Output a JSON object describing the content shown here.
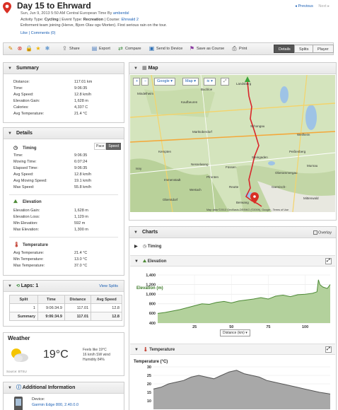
{
  "header": {
    "title": "Day 15 to Ehrward",
    "date": "Sun, Jun 9, 2013 5:50 AM Central European Time",
    "by_label": "By",
    "user": "amberdsl",
    "activity_label": "Activity Type:",
    "activity": "Cycling",
    "event_label": "Event Type:",
    "event": "Recreation",
    "course_label": "Course:",
    "course": "Ehrwald 2",
    "description": "Enforment team joining (Herve, Bjorn Olav ogv Morten). First serious rain on the tour.",
    "likes": "Like",
    "comments": "Comments (0)",
    "prev": "Previous",
    "next": "Next"
  },
  "toolbar": {
    "share": "Share",
    "export": "Export",
    "compare": "Compare",
    "send": "Send to Device",
    "save_course": "Save as Course",
    "print": "Print",
    "tabs": [
      "Details",
      "Splits",
      "Player"
    ]
  },
  "summary": {
    "title": "Summary",
    "rows": [
      {
        "label": "Distance:",
        "value": "117.01 km"
      },
      {
        "label": "Time:",
        "value": "9:06:35"
      },
      {
        "label": "Avg Speed:",
        "value": "12.8 km/h"
      },
      {
        "label": "Elevation Gain:",
        "value": "1,628 m"
      },
      {
        "label": "Calories:",
        "value": "4,337 C"
      },
      {
        "label": "Avg Temperature:",
        "value": "21.4 °C"
      }
    ]
  },
  "details": {
    "title": "Details",
    "timing": {
      "title": "Timing",
      "toggle": [
        "Pace",
        "Speed"
      ],
      "rows": [
        {
          "label": "Time:",
          "value": "9:06:35"
        },
        {
          "label": "Moving Time:",
          "value": "6:07:24"
        },
        {
          "label": "Elapsed Time:",
          "value": "9:06:35"
        },
        {
          "label": "Avg Speed:",
          "value": "12.8 km/h"
        },
        {
          "label": "Avg Moving Speed:",
          "value": "19.1 km/h"
        },
        {
          "label": "Max Speed:",
          "value": "55.8 km/h"
        }
      ]
    },
    "elevation": {
      "title": "Elevation",
      "rows": [
        {
          "label": "Elevation Gain:",
          "value": "1,628 m"
        },
        {
          "label": "Elevation Loss:",
          "value": "1,129 m"
        },
        {
          "label": "Min Elevation:",
          "value": "592 m"
        },
        {
          "label": "Max Elevation:",
          "value": "1,300 m"
        }
      ]
    },
    "temperature": {
      "title": "Temperature",
      "rows": [
        {
          "label": "Avg Temperature:",
          "value": "21.4 °C"
        },
        {
          "label": "Min Temperature:",
          "value": "13.0 °C"
        },
        {
          "label": "Max Temperature:",
          "value": "37.0 °C"
        }
      ]
    }
  },
  "laps": {
    "title": "Laps",
    "count": "1",
    "view_splits": "View Splits",
    "columns": [
      "Split",
      "Time",
      "Distance",
      "Avg Speed"
    ],
    "rows": [
      [
        "1",
        "9:06:34.9",
        "117.01",
        "12.8"
      ]
    ],
    "summary": [
      "Summary",
      "9:06:34.9",
      "117.01",
      "12.8"
    ]
  },
  "weather": {
    "title": "Weather",
    "temp": "19°C",
    "feels": "Feels like 19°C",
    "wind": "16 km/h SW wind",
    "humidity": "Humidity 84%",
    "source": "Source: BTSU"
  },
  "additional": {
    "title": "Additional Information",
    "device_label": "Device:",
    "device": "Garmin Edge 800, 2.40.0.0"
  },
  "map": {
    "title": "Map",
    "type_selector": "Google",
    "view_selector": "Map",
    "copyright": "Map data ©2013 GeoBasis-DE/BKG (©2009), Google - Terms of Use",
    "labels": [
      "Landsberg am Lech",
      "Kaufbeuren",
      "Marktoberdorf",
      "Schongau",
      "Weilheim in Oberbayern",
      "Peißenberg",
      "Füssen",
      "Reutte",
      "Garmisch-Partenkirchen",
      "Oberammergau",
      "Kempten",
      "Immenstadt",
      "Nesselwang",
      "Pfronten",
      "Berwang",
      "Ehrwald",
      "Murnau",
      "Steingaden",
      "Buchloe",
      "Mindelheim",
      "Isny",
      "Wertach",
      "Oberstdorf",
      "Mittenwald"
    ]
  },
  "charts": {
    "title": "Charts",
    "overlay": "Overlay",
    "timing_label": "Timing",
    "elevation_label": "Elevation",
    "temperature_label": "Temperature",
    "x_selector": "Distance (km)"
  },
  "chart_data": [
    {
      "type": "area",
      "title": "Elevation",
      "ylabel": "Elevation (m)",
      "xlabel": "Distance (km)",
      "ylim": [
        400,
        1400
      ],
      "xlim": [
        0,
        117
      ],
      "yticks": [
        400,
        600,
        800,
        1000,
        1200,
        1400
      ],
      "xticks": [
        25,
        50,
        75,
        100
      ],
      "x": [
        0,
        5,
        10,
        15,
        20,
        25,
        30,
        35,
        40,
        45,
        50,
        55,
        60,
        65,
        70,
        75,
        80,
        85,
        90,
        95,
        100,
        105,
        108,
        109,
        110,
        112,
        115,
        117
      ],
      "y": [
        600,
        620,
        650,
        680,
        720,
        760,
        800,
        790,
        830,
        850,
        820,
        860,
        880,
        900,
        930,
        900,
        960,
        980,
        950,
        990,
        1000,
        1020,
        1050,
        1300,
        1200,
        1150,
        1120,
        1200
      ],
      "color": "#4d8a36"
    },
    {
      "type": "area",
      "title": "Temperature",
      "ylabel": "Temperature (°C)",
      "yticks": [
        10,
        15,
        20,
        25,
        30
      ],
      "x": [
        0,
        5,
        10,
        15,
        20,
        25,
        30,
        35,
        40,
        45,
        50,
        55,
        60,
        65,
        70,
        75,
        80,
        85,
        90,
        95,
        100,
        105,
        110,
        117
      ],
      "y": [
        17,
        18,
        20,
        21,
        22,
        24,
        25,
        24,
        23,
        25,
        27,
        28,
        26,
        25,
        24,
        22,
        21,
        20,
        19,
        18,
        17,
        16,
        15,
        14
      ],
      "color": "#555555"
    }
  ]
}
